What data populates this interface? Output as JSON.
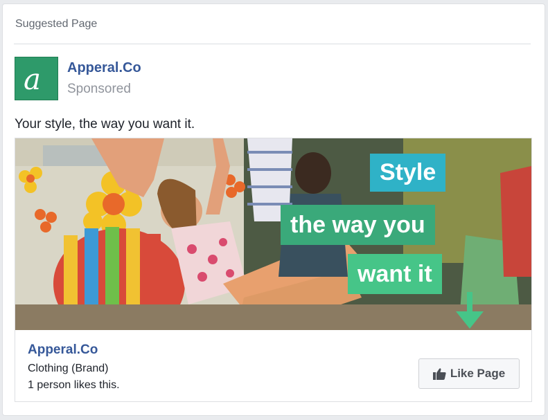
{
  "header": {
    "label": "Suggested Page"
  },
  "post": {
    "page_name": "Apperal.Co",
    "sponsored": "Sponsored",
    "logo_letter": "a",
    "text": "Your style, the way you want it."
  },
  "ad_image": {
    "caption_lines": [
      "Style",
      "the way you",
      "want it"
    ],
    "colors": {
      "line1": "#2fb2c7",
      "line2": "#3aa97a",
      "line3": "#46c588"
    }
  },
  "attachment_footer": {
    "page_name": "Apperal.Co",
    "category": "Clothing (Brand)",
    "likes": "1 person likes this.",
    "like_button_label": "Like Page",
    "like_icon": "thumbs-up-icon"
  },
  "colors": {
    "link": "#365899",
    "muted": "#90949c",
    "brand_green": "#2e9a6a"
  }
}
